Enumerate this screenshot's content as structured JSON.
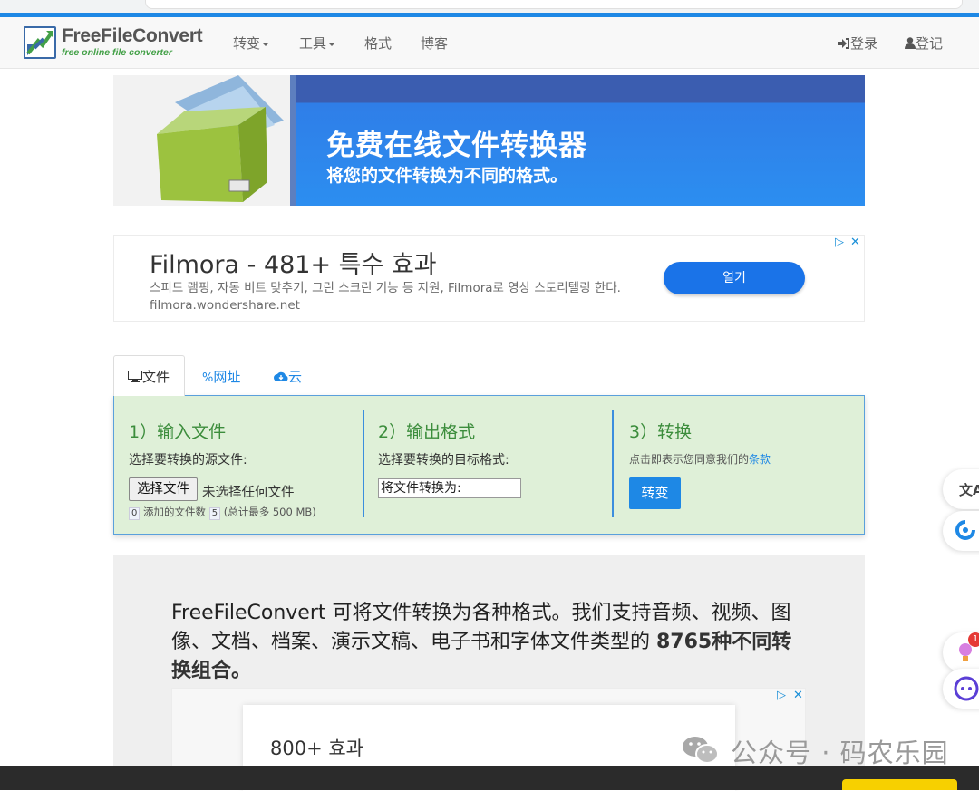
{
  "nav": {
    "logo_title": "FreeFileConvert",
    "logo_subtitle": "free online file converter",
    "menu": [
      "转变",
      "工具",
      "格式",
      "博客"
    ],
    "login": "登录",
    "register": "登记"
  },
  "banner": {
    "title": "免费在线文件转换器",
    "subtitle": "将您的文件转换为不同的格式。"
  },
  "ad": {
    "title": "Filmora - 481+ 특수 효과",
    "description": "스피드 램핑, 자동 비트 맞추기, 그린 스크린 기능 등 지원, Filmora로 영상 스토리텔링 한다. filmora.wondershare.net",
    "button": "열기"
  },
  "tabs": {
    "file": "文件",
    "url": "网址",
    "cloud": "云"
  },
  "converter": {
    "step1": {
      "title": "1）输入文件",
      "desc": "选择要转换的源文件:",
      "choose_button": "选择文件",
      "no_file": "未选择任何文件",
      "count_badge": "0",
      "added_label": "添加的文件数",
      "max_badge": "5",
      "limit": "(总计最多 500 MB)"
    },
    "step2": {
      "title": "2）输出格式",
      "desc": "选择要转换的目标格式:",
      "select_value": "将文件转换为:"
    },
    "step3": {
      "title": "3）转换",
      "terms_prefix": "点击即表示您同意我们的",
      "terms_link": "条款",
      "button": "转变"
    }
  },
  "description": {
    "text_plain": "FreeFileConvert 可将文件转换为各种格式。我们支持音频、视频、图像、文档、档案、演示文稿、电子书和字体文件类型的 ",
    "text_bold": "8765种不同转换组合。"
  },
  "ad2": {
    "title": "800+ 효과"
  },
  "watermark": {
    "text": "公众号 · 码农乐园"
  },
  "side": {
    "badge_count": "1"
  },
  "colors": {
    "brand_blue": "#1e88e5",
    "panel_green": "#dff0d8",
    "step_green": "#3c8d3c"
  }
}
